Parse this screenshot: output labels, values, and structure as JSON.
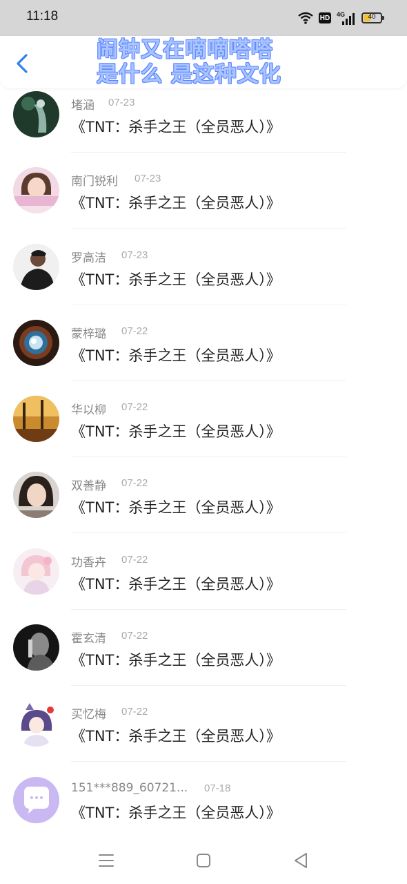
{
  "status_bar": {
    "time": "11:18",
    "network": "4G",
    "hd": "HD",
    "battery": "40"
  },
  "header": {
    "title_line1": "闹钟又在嘀嘀嗒嗒",
    "title_line2": "是什么 是这种文化",
    "accent": "#2f80ed"
  },
  "comments": [
    {
      "name": "堵涵",
      "date": "07-23",
      "text": "《TNT：杀手之王（全员恶人）》"
    },
    {
      "name": "南门锐利",
      "date": "07-23",
      "text": "《TNT：杀手之王（全员恶人）》"
    },
    {
      "name": "罗高洁",
      "date": "07-23",
      "text": "《TNT：杀手之王（全员恶人）》"
    },
    {
      "name": "蒙梓璐",
      "date": "07-22",
      "text": "《TNT：杀手之王（全员恶人）》"
    },
    {
      "name": "华以柳",
      "date": "07-22",
      "text": "《TNT：杀手之王（全员恶人）》"
    },
    {
      "name": "双善静",
      "date": "07-22",
      "text": "《TNT：杀手之王（全员恶人）》"
    },
    {
      "name": "功香卉",
      "date": "07-22",
      "text": "《TNT：杀手之王（全员恶人）》"
    },
    {
      "name": "霍玄清",
      "date": "07-22",
      "text": "《TNT：杀手之王（全员恶人）》"
    },
    {
      "name": "买忆梅",
      "date": "07-22",
      "text": "《TNT：杀手之王（全员恶人）》"
    },
    {
      "name": "151***889_60721...",
      "date": "07-18",
      "text": "《TNT：杀手之王（全员恶人）》"
    }
  ]
}
